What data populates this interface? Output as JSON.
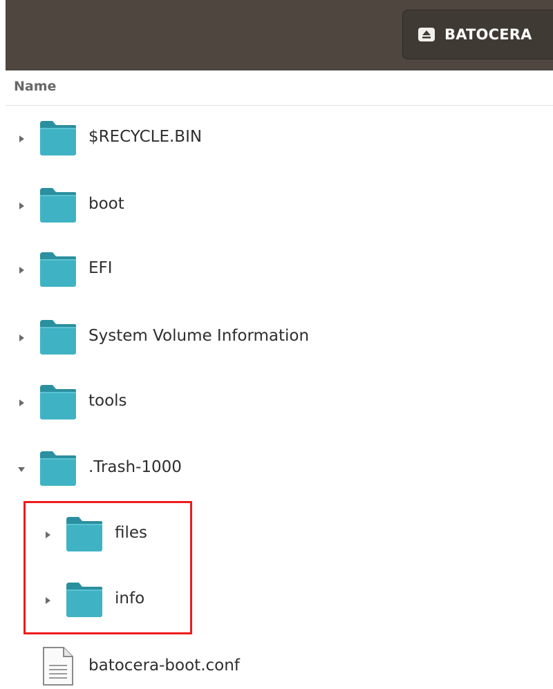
{
  "toolbar": {
    "eject_label": "BATOCERA",
    "eject_icon": "eject-icon"
  },
  "header": {
    "name_label": "Name"
  },
  "rows": [
    {
      "label": "$RECYCLE.BIN",
      "type": "folder",
      "expanded": false
    },
    {
      "label": "boot",
      "type": "folder",
      "expanded": false
    },
    {
      "label": "EFI",
      "type": "folder",
      "expanded": false
    },
    {
      "label": "System Volume Information",
      "type": "folder",
      "expanded": false
    },
    {
      "label": "tools",
      "type": "folder",
      "expanded": false
    },
    {
      "label": ".Trash-1000",
      "type": "folder",
      "expanded": true
    },
    {
      "label": "files",
      "type": "folder",
      "expanded": false
    },
    {
      "label": "info",
      "type": "folder",
      "expanded": false
    },
    {
      "label": "batocera-boot.conf",
      "type": "file"
    }
  ],
  "colors": {
    "toolbar_bg": "#4e463f",
    "folder_body": "#3fb3c4",
    "folder_tab": "#2a8f9f",
    "highlight": "#ee1c1c"
  }
}
